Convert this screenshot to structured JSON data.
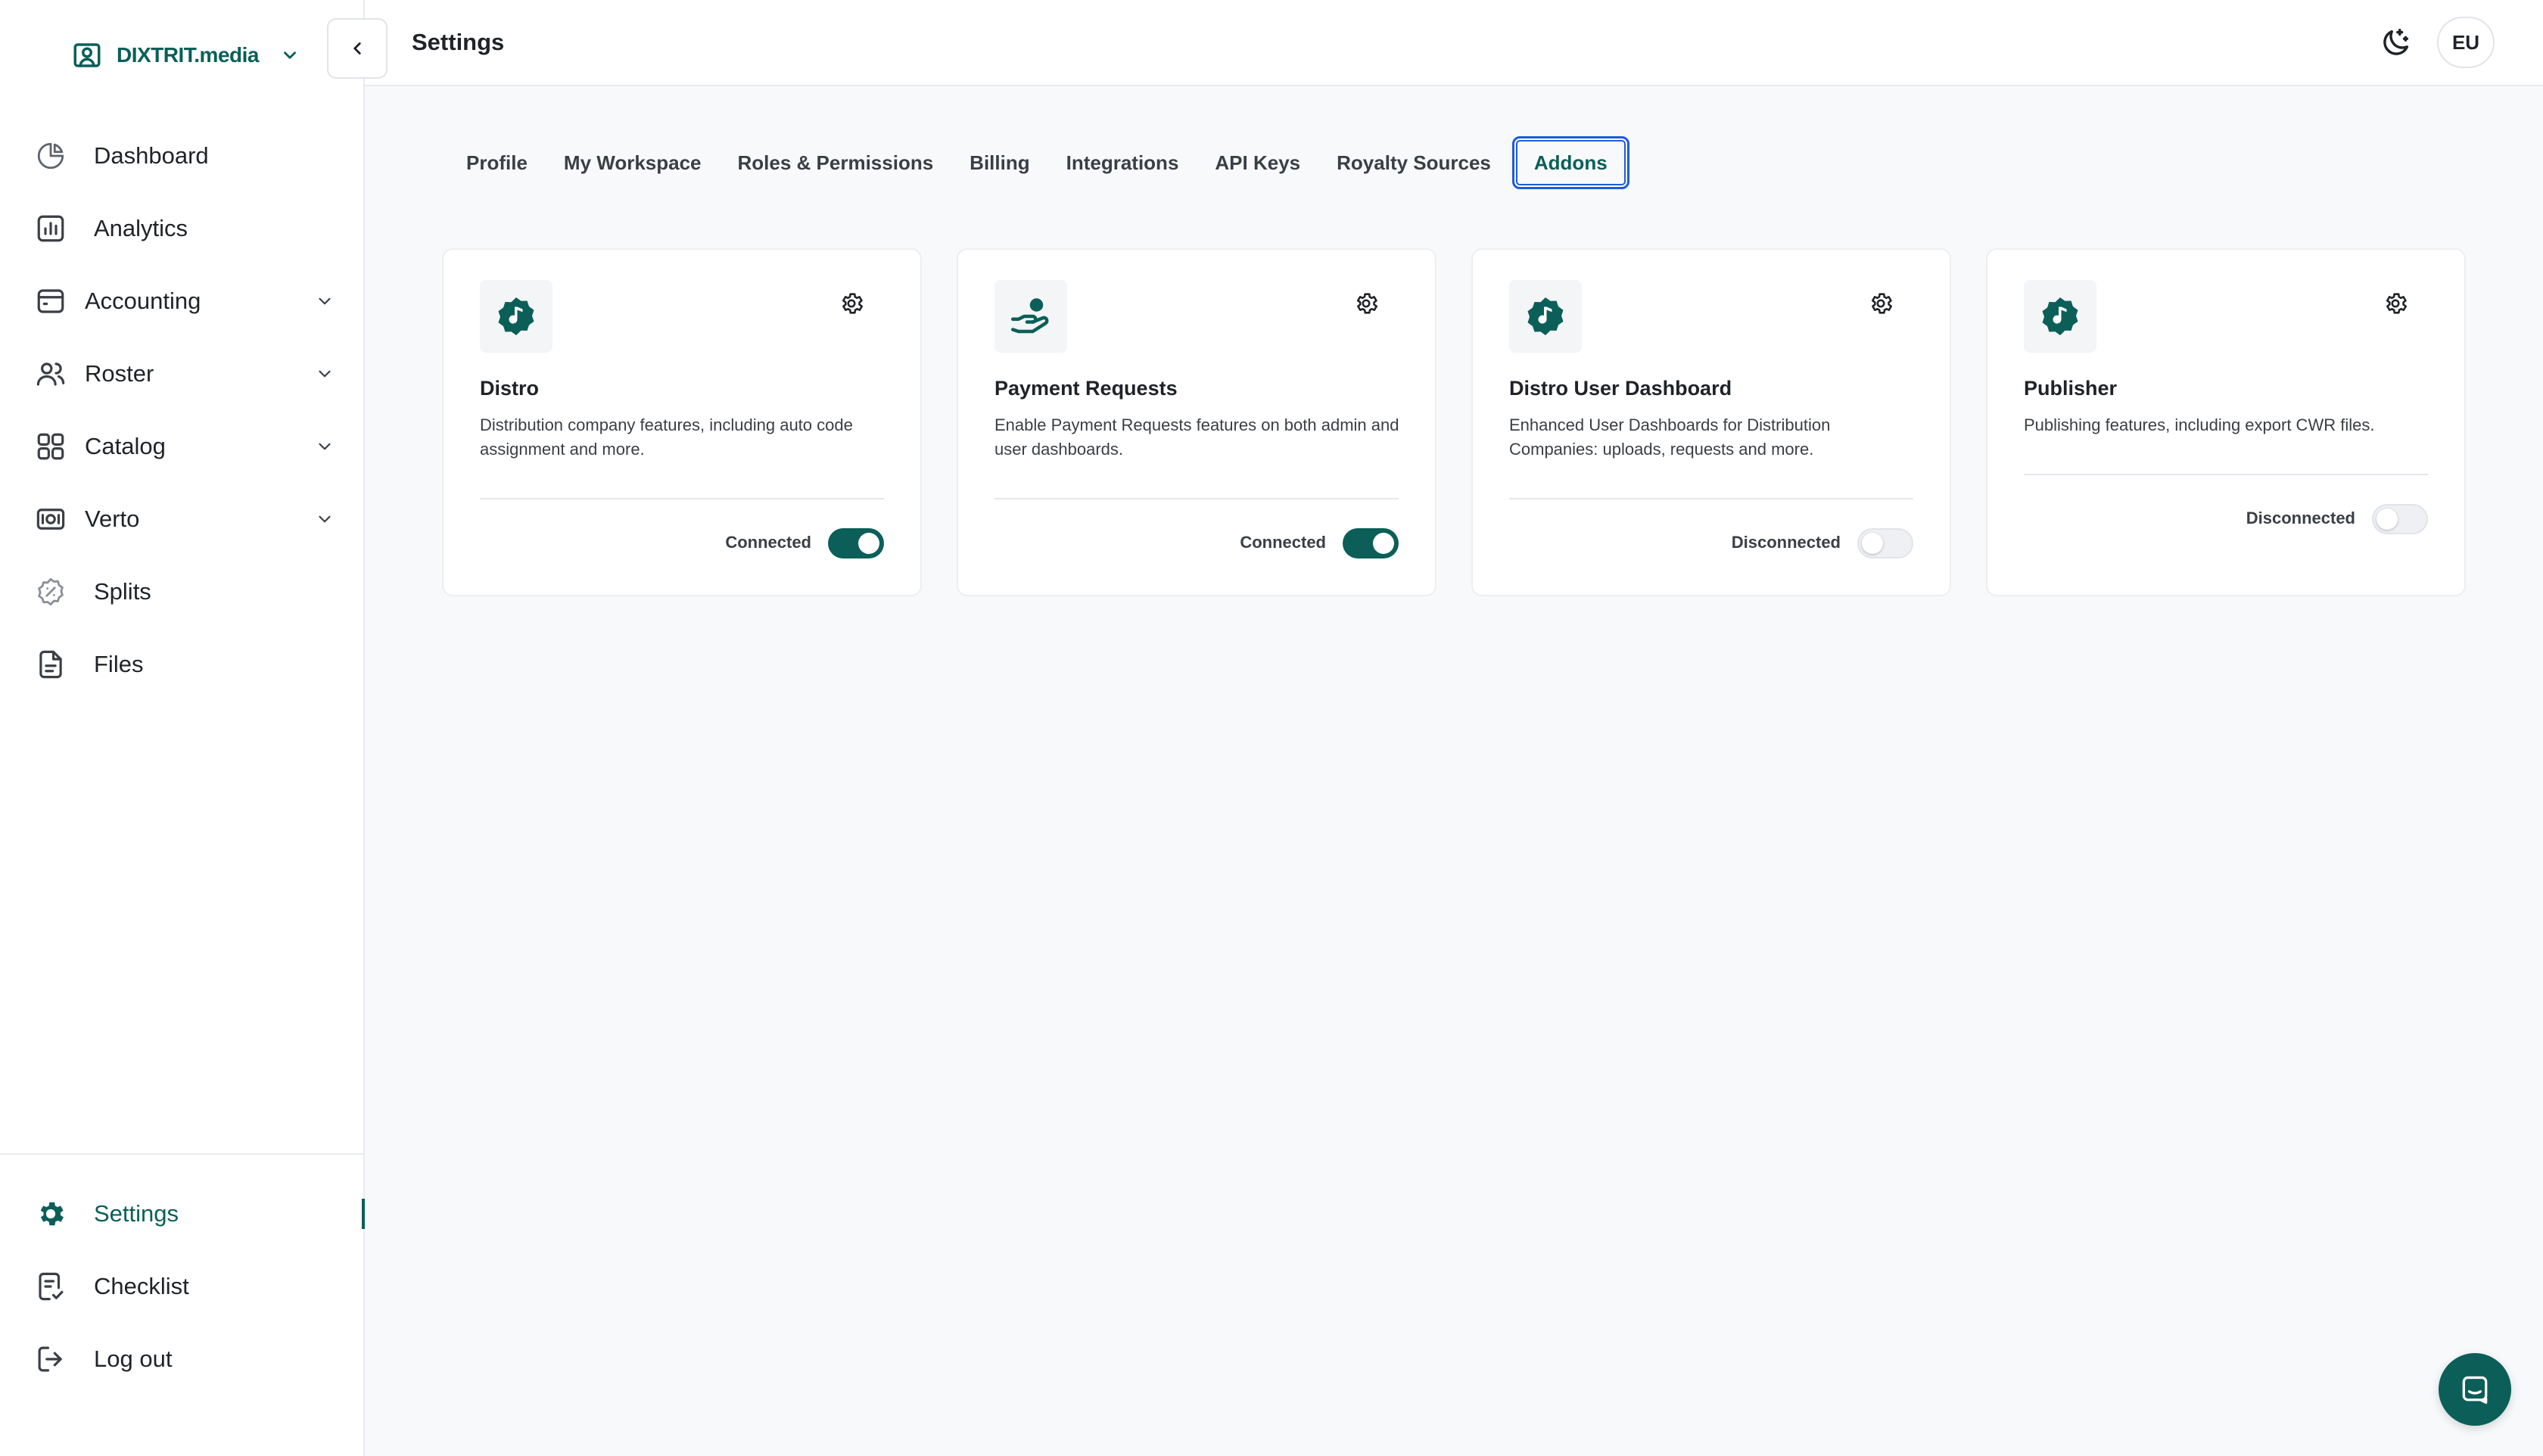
{
  "brand": {
    "name": "DIXTRIT.media",
    "icon": "user-card-icon"
  },
  "header": {
    "title": "Settings",
    "theme_icon": "moon-stars-icon",
    "avatar_initials": "EU"
  },
  "sidebar": {
    "items": [
      {
        "label": "Dashboard",
        "icon": "pie-chart-icon",
        "has_children": false
      },
      {
        "label": "Analytics",
        "icon": "bar-chart-icon",
        "has_children": false
      },
      {
        "label": "Accounting",
        "icon": "wallet-icon",
        "has_children": true
      },
      {
        "label": "Roster",
        "icon": "users-icon",
        "has_children": true
      },
      {
        "label": "Catalog",
        "icon": "grid-icon",
        "has_children": true
      },
      {
        "label": "Verto",
        "icon": "banknote-icon",
        "has_children": true
      },
      {
        "label": "Splits",
        "icon": "split-badge-icon",
        "has_children": false
      },
      {
        "label": "Files",
        "icon": "file-icon",
        "has_children": false
      }
    ],
    "bottom_items": [
      {
        "label": "Settings",
        "icon": "gear-icon",
        "active": true
      },
      {
        "label": "Checklist",
        "icon": "checklist-icon",
        "active": false
      },
      {
        "label": "Log out",
        "icon": "logout-icon",
        "active": false
      }
    ]
  },
  "tabs": [
    {
      "label": "Profile",
      "active": false
    },
    {
      "label": "My Workspace",
      "active": false
    },
    {
      "label": "Roles & Permissions",
      "active": false
    },
    {
      "label": "Billing",
      "active": false
    },
    {
      "label": "Integrations",
      "active": false
    },
    {
      "label": "API Keys",
      "active": false
    },
    {
      "label": "Royalty Sources",
      "active": false
    },
    {
      "label": "Addons",
      "active": true
    }
  ],
  "addons": [
    {
      "title": "Distro",
      "description": "Distribution company features, including auto code assignment and more.",
      "status": "Connected",
      "enabled": true,
      "icon": "music-badge-icon"
    },
    {
      "title": "Payment Requests",
      "description": "Enable Payment Requests features on both admin and user dashboards.",
      "status": "Connected",
      "enabled": true,
      "icon": "hand-coin-icon"
    },
    {
      "title": "Distro User Dashboard",
      "description": "Enhanced User Dashboards for Distribution Companies: uploads, requests and more.",
      "status": "Disconnected",
      "enabled": false,
      "icon": "music-badge-icon"
    },
    {
      "title": "Publisher",
      "description": "Publishing features, including export CWR files.",
      "status": "Disconnected",
      "enabled": false,
      "icon": "music-badge-icon"
    }
  ],
  "colors": {
    "brand": "#0b5f58",
    "focus_ring": "#1e5dd8",
    "background": "#f8f9fb"
  }
}
